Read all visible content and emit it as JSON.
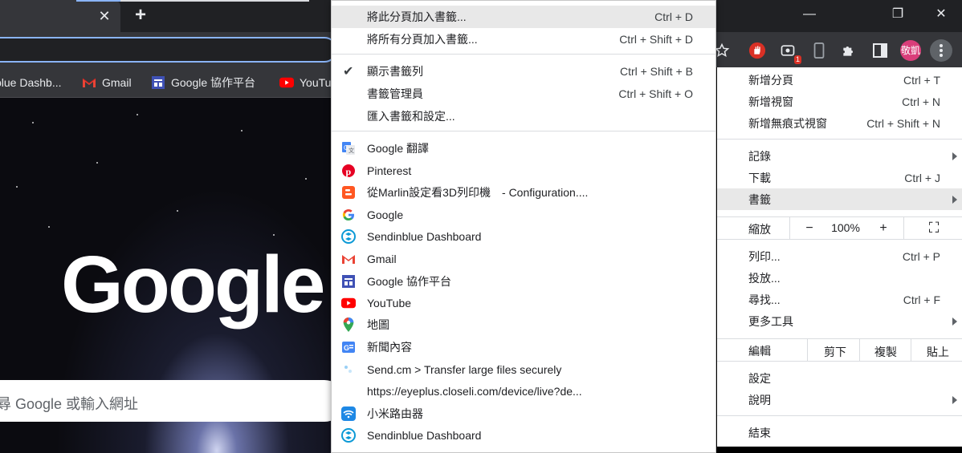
{
  "tab": {
    "close_glyph": "✕",
    "new_glyph": "+"
  },
  "window_controls": {
    "minimize": "—",
    "maximize": "❐",
    "close": "✕"
  },
  "toolbar": {
    "avatar_text": "敬凱",
    "extension_badge": "1"
  },
  "bookmarks_bar": [
    {
      "label": "blue Dashb...",
      "icon": "sendinblue-icon"
    },
    {
      "label": "Gmail",
      "icon": "gmail-icon"
    },
    {
      "label": "Google 協作平台",
      "icon": "google-sites-icon"
    },
    {
      "label": "YouTu",
      "icon": "youtube-icon"
    }
  ],
  "new_tab_page": {
    "logo": "Google",
    "search_placeholder": "尋 Google 或輸入網址"
  },
  "bookmarks_submenu": {
    "actions": [
      {
        "label": "將此分頁加入書籤...",
        "shortcut": "Ctrl + D"
      },
      {
        "label": "將所有分頁加入書籤...",
        "shortcut": "Ctrl + Shift + D"
      }
    ],
    "management": [
      {
        "label": "顯示書籤列",
        "shortcut": "Ctrl + Shift + B",
        "checked": "✔"
      },
      {
        "label": "書籤管理員",
        "shortcut": "Ctrl + Shift + O"
      },
      {
        "label": "匯入書籤和設定..."
      }
    ],
    "bookmarks": [
      {
        "label": "Google 翻譯",
        "icon": "google-translate-icon"
      },
      {
        "label": "Pinterest",
        "icon": "pinterest-icon"
      },
      {
        "label": "從Marlin設定看3D列印機　- Configuration....",
        "icon": "blogger-icon"
      },
      {
        "label": "Google",
        "icon": "google-icon"
      },
      {
        "label": "Sendinblue Dashboard",
        "icon": "sendinblue-icon"
      },
      {
        "label": "Gmail",
        "icon": "gmail-icon"
      },
      {
        "label": "Google 協作平台",
        "icon": "google-sites-icon"
      },
      {
        "label": "YouTube",
        "icon": "youtube-icon"
      },
      {
        "label": "地圖",
        "icon": "google-maps-icon"
      },
      {
        "label": "新聞內容",
        "icon": "google-news-icon"
      },
      {
        "label": "Send.cm > Transfer large files securely",
        "icon": "sendcm-icon"
      },
      {
        "label": "https://eyeplus.closeli.com/device/live?de...",
        "icon": "blank-page-icon"
      },
      {
        "label": "小米路由器",
        "icon": "wifi-icon"
      },
      {
        "label": "Sendinblue Dashboard",
        "icon": "sendinblue-icon"
      }
    ]
  },
  "main_menu": {
    "group1": [
      {
        "label": "新增分頁",
        "shortcut": "Ctrl + T"
      },
      {
        "label": "新增視窗",
        "shortcut": "Ctrl + N"
      },
      {
        "label": "新增無痕式視窗",
        "shortcut": "Ctrl + Shift + N"
      }
    ],
    "group2": [
      {
        "label": "記錄",
        "shortcut": ""
      },
      {
        "label": "下載",
        "shortcut": "Ctrl + J"
      },
      {
        "label": "書籤",
        "shortcut": ""
      }
    ],
    "zoom": {
      "label": "縮放",
      "minus": "−",
      "value": "100%",
      "plus": "+",
      "fullscreen": "⛶"
    },
    "group3": [
      {
        "label": "列印...",
        "shortcut": "Ctrl + P"
      },
      {
        "label": "投放...",
        "shortcut": ""
      },
      {
        "label": "尋找...",
        "shortcut": "Ctrl + F"
      },
      {
        "label": "更多工具",
        "shortcut": ""
      }
    ],
    "edit": {
      "label": "編輯",
      "cut": "剪下",
      "copy": "複製",
      "paste": "貼上"
    },
    "group4": [
      {
        "label": "設定"
      },
      {
        "label": "說明"
      }
    ],
    "exit": {
      "label": "結束"
    }
  }
}
